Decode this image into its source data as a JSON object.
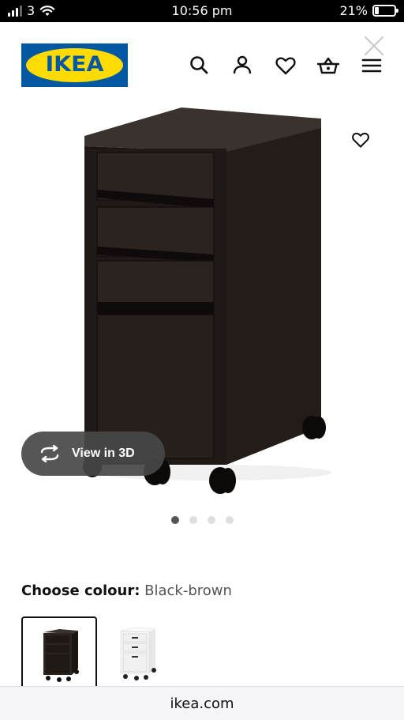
{
  "status_bar": {
    "carrier": "3",
    "time": "10:56 pm",
    "battery": "21%",
    "battery_level": 0.21
  },
  "header": {
    "logo_text": "IKEA",
    "icons": [
      "search-icon",
      "user-icon",
      "heart-icon",
      "basket-icon",
      "menu-icon",
      "close-icon"
    ],
    "colors": {
      "logo_blue": "#0058a3",
      "logo_yellow": "#ffdb00"
    }
  },
  "product": {
    "view3d_label": "View in 3D",
    "carousel": {
      "count": 4,
      "active_index": 0
    },
    "colour": {
      "label": "Choose colour:",
      "value": "Black-brown"
    },
    "swatches": [
      {
        "name": "Black-brown",
        "color": "#2b2420",
        "selected": true
      },
      {
        "name": "White",
        "color": "#f4f4f4",
        "selected": false
      }
    ]
  },
  "browser": {
    "url": "ikea.com"
  }
}
